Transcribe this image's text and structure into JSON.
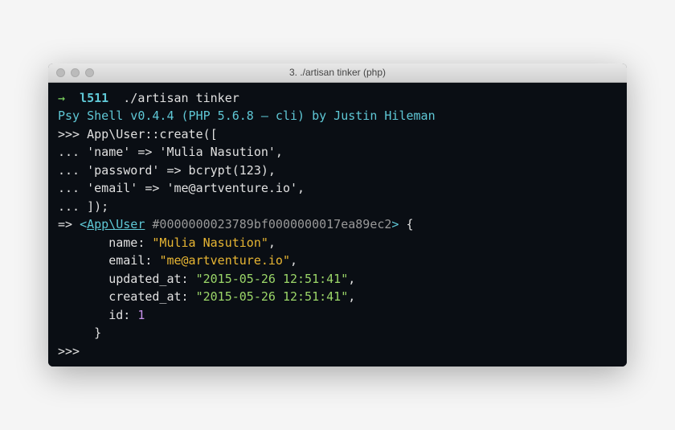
{
  "window": {
    "title": "3. ./artisan tinker (php)"
  },
  "prompt": {
    "arrow": "→",
    "dir": "l511",
    "command": "./artisan tinker"
  },
  "banner": "Psy Shell v0.4.4 (PHP 5.6.8 — cli) by Justin Hileman",
  "input": {
    "p1": ">>> ",
    "l1": "App\\User::create([",
    "pc": "... ",
    "l2": "'name' => 'Mulia Nasution',",
    "l3": "'password' => bcrypt(123),",
    "l4": "'email' => 'me@artventure.io',",
    "l5": "]);"
  },
  "output": {
    "arrow": "=> ",
    "angle_open": "<",
    "class": "App\\User",
    "hash": " #0000000023789bf0000000017ea89ec2",
    "angle_close": ">",
    "brace_open": " {",
    "name_key": "       name: ",
    "name_val": "\"Mulia Nasution\"",
    "email_key": "       email: ",
    "email_val": "\"me@artventure.io\"",
    "updated_key": "       updated_at: ",
    "updated_val": "\"2015-05-26 12:51:41\"",
    "created_key": "       created_at: ",
    "created_val": "\"2015-05-26 12:51:41\"",
    "id_key": "       id: ",
    "id_val": "1",
    "brace_close": "     }",
    "comma": ","
  },
  "final_prompt": ">>> "
}
